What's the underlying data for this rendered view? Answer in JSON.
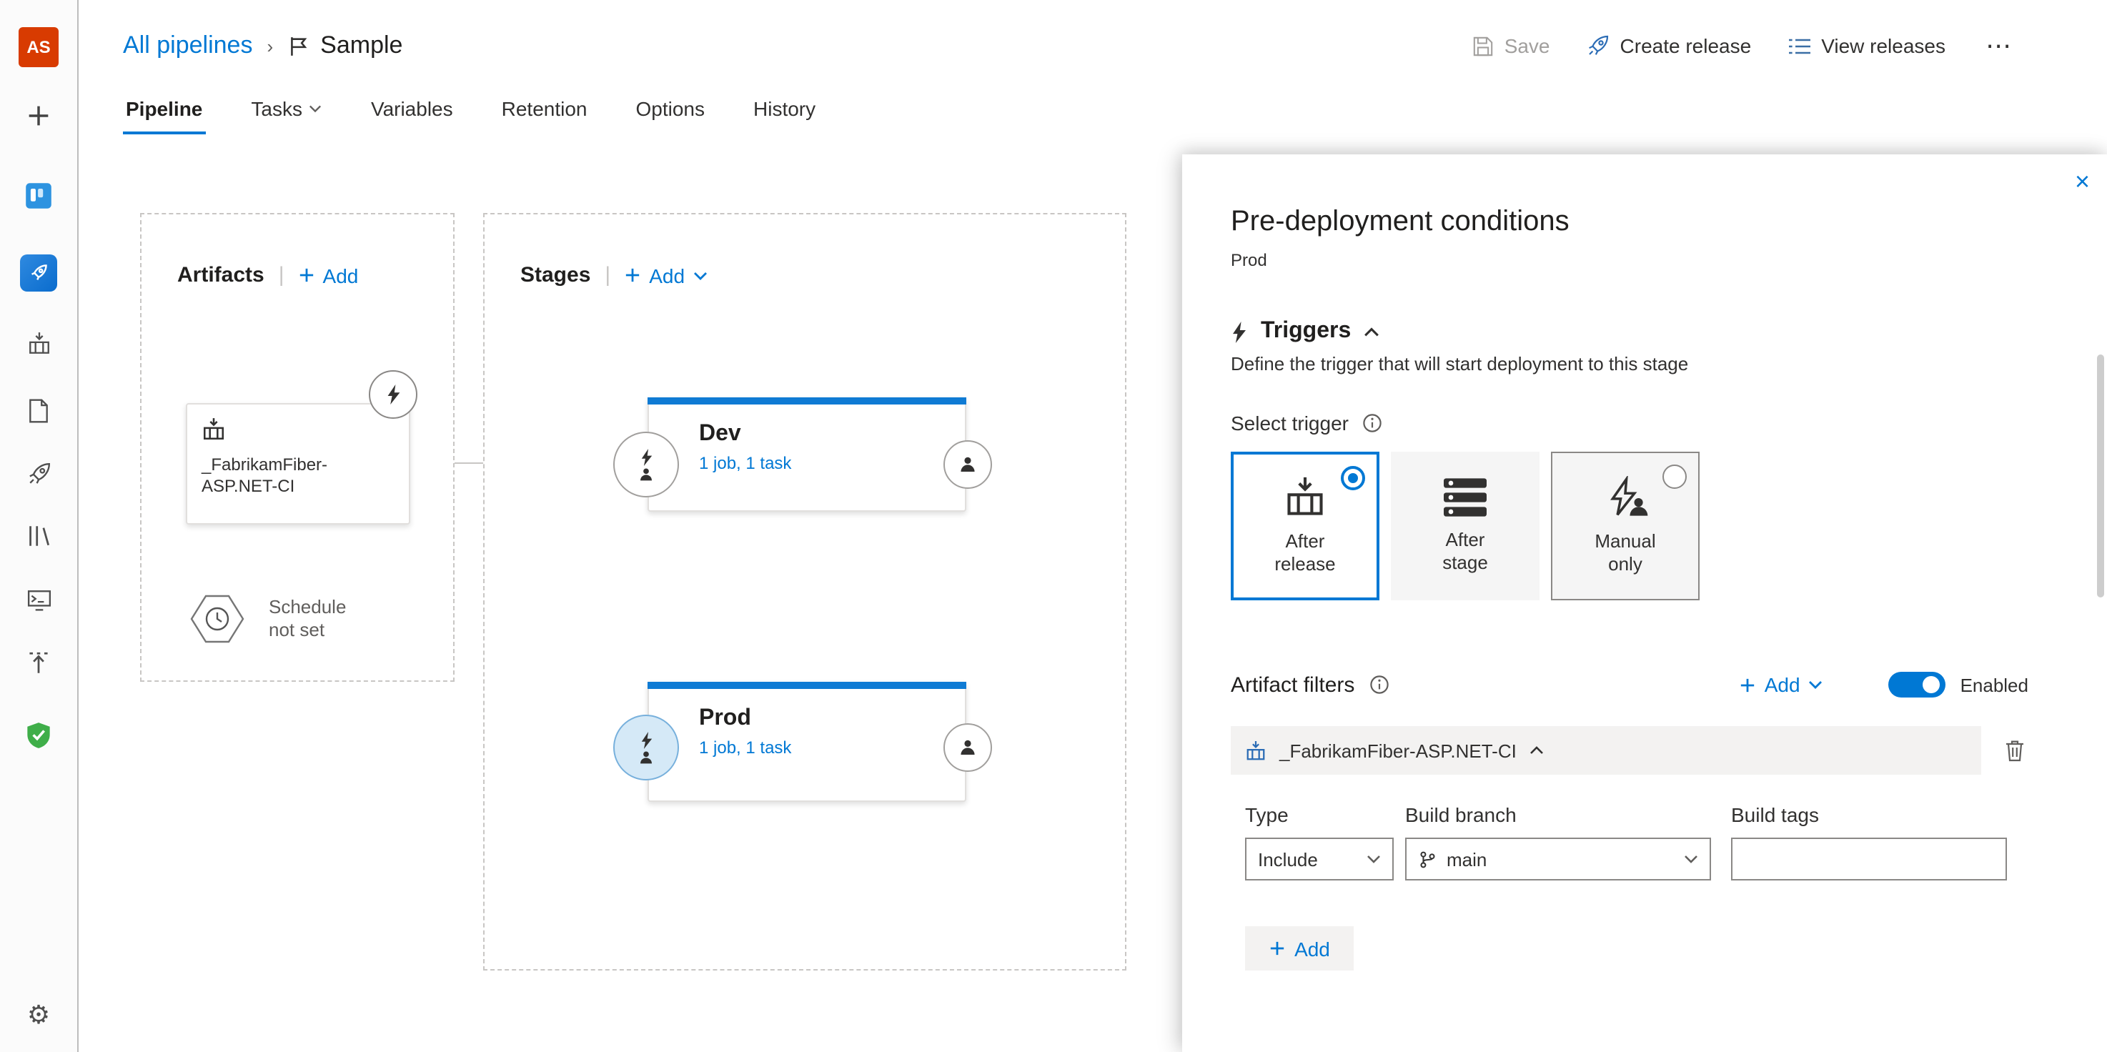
{
  "colors": {
    "accent": "#0078d4",
    "avatar_bg": "#d83b01",
    "stage_bar": "#0f7bd4",
    "security_green": "#3fae49"
  },
  "sidebar": {
    "avatar_initials": "AS"
  },
  "header": {
    "breadcrumb": "All pipelines",
    "separator": "›",
    "title": "Sample",
    "actions": {
      "save": "Save",
      "create_release": "Create release",
      "view_releases": "View releases",
      "more": "⋯"
    }
  },
  "tabs": {
    "items": [
      {
        "label": "Pipeline",
        "active": true
      },
      {
        "label": "Tasks",
        "dropdown": true
      },
      {
        "label": "Variables"
      },
      {
        "label": "Retention"
      },
      {
        "label": "Options"
      },
      {
        "label": "History"
      }
    ]
  },
  "canvas": {
    "artifacts": {
      "title": "Artifacts",
      "divider": "|",
      "add_label": "Add",
      "card": {
        "name_line1": "_FabrikamFiber-",
        "name_line2": "ASP.NET-CI"
      },
      "schedule_line1": "Schedule",
      "schedule_line2": "not set"
    },
    "stages": {
      "title": "Stages",
      "divider": "|",
      "add_label": "Add",
      "dev": {
        "name": "Dev",
        "meta": "1 job, 1 task"
      },
      "prod": {
        "name": "Prod",
        "meta": "1 job, 1 task",
        "selected": true
      }
    }
  },
  "panel": {
    "close": "×",
    "title": "Pre-deployment conditions",
    "subtitle": "Prod",
    "triggers": {
      "heading": "Triggers",
      "description": "Define the trigger that will start deployment to this stage",
      "select_label": "Select trigger",
      "options": [
        {
          "label": "After release",
          "selected": true
        },
        {
          "label": "After stage",
          "selected": false
        },
        {
          "label": "Manual only",
          "selected": false
        }
      ]
    },
    "filters": {
      "heading": "Artifact filters",
      "add_label": "Add",
      "toggle_label": "Enabled",
      "toggle_on": true,
      "artifact_name": "_FabrikamFiber-ASP.NET-CI",
      "columns": {
        "type": "Type",
        "branch": "Build branch",
        "tags": "Build tags"
      },
      "type_value": "Include",
      "branch_value": "main",
      "tags_value": "",
      "row_add_label": "Add"
    }
  }
}
